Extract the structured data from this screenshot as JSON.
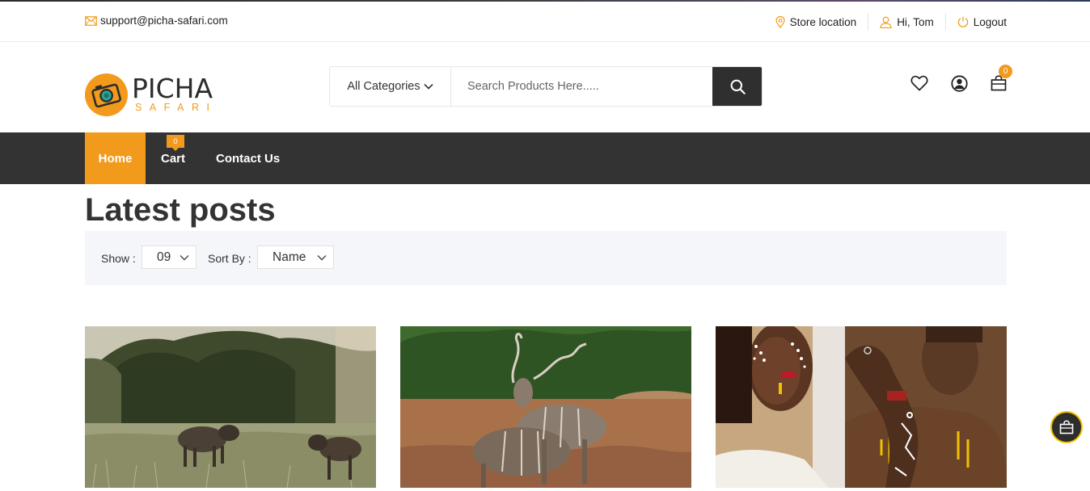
{
  "topbar": {
    "email": "support@picha-safari.com",
    "store_location": "Store location",
    "greeting": "Hi, Tom",
    "logout": "Logout"
  },
  "logo": {
    "main": "PICHA",
    "sub": "SAFARI"
  },
  "search": {
    "category": "All Categories",
    "placeholder": "Search Products Here....."
  },
  "header_icons": {
    "cart_count": "0"
  },
  "nav": {
    "items": [
      {
        "label": "Home",
        "active": true
      },
      {
        "label": "Cart",
        "badge": "0"
      },
      {
        "label": "Contact Us"
      }
    ]
  },
  "main": {
    "title": "Latest posts",
    "show_label": "Show :",
    "show_value": "09",
    "sort_label": "Sort By :",
    "sort_value": "Name"
  },
  "posts": [
    {
      "icon": "warthog-photo"
    },
    {
      "icon": "kudu-photo"
    },
    {
      "icon": "face-paint-photo"
    }
  ],
  "colors": {
    "accent": "#f29a1c",
    "dark": "#333333",
    "filter_bg": "#f5f6fa"
  }
}
